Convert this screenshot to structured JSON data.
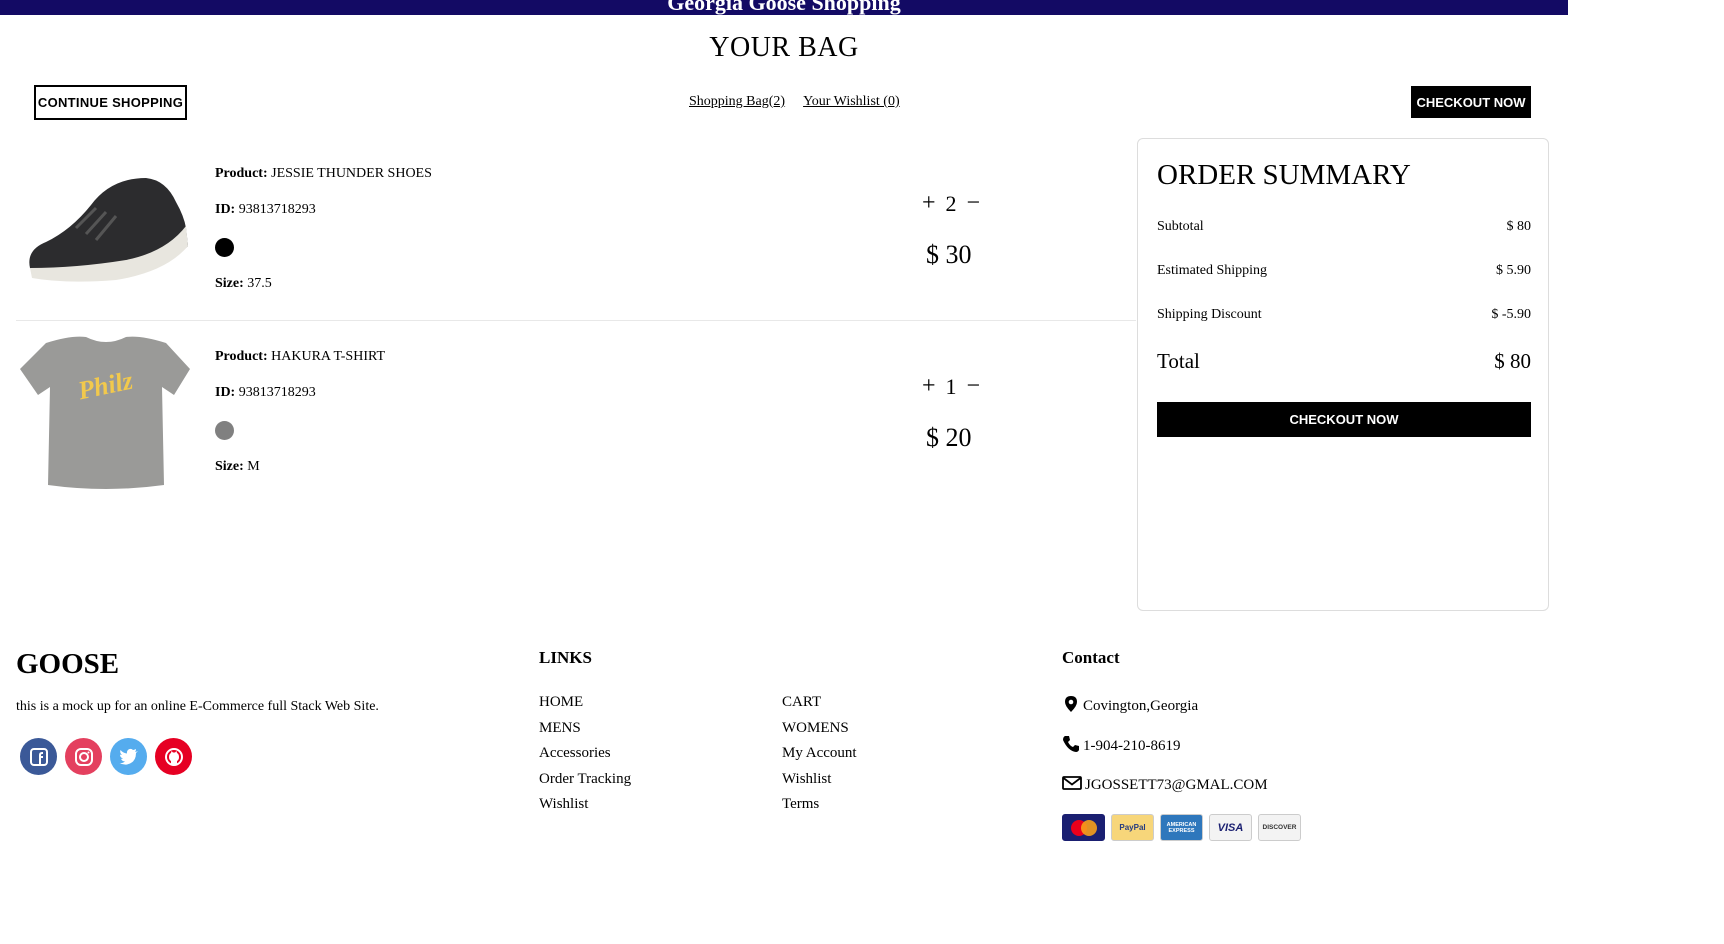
{
  "header": {
    "site_title": "Georgia Goose Shopping"
  },
  "page": {
    "title": "YOUR BAG"
  },
  "toolbar": {
    "continue_label": "CONTINUE SHOPPING",
    "shopping_bag_link": "Shopping Bag(2)",
    "wishlist_link": "Your Wishlist (0)",
    "checkout_label": "CHECKOUT NOW"
  },
  "cart": {
    "items": [
      {
        "product_label": "Product:",
        "product": "JESSIE THUNDER SHOES",
        "id_label": "ID:",
        "id": "93813718293",
        "color": "#000000",
        "size_label": "Size:",
        "size": "37.5",
        "plus": "+",
        "minus": "−",
        "quantity": "2",
        "price": "$ 30",
        "image_icon": "shoe-image"
      },
      {
        "product_label": "Product:",
        "product": "HAKURA T-SHIRT",
        "id_label": "ID:",
        "id": "93813718293",
        "color": "#808080",
        "size_label": "Size:",
        "size": "M",
        "plus": "+",
        "minus": "−",
        "quantity": "1",
        "price": "$ 20",
        "image_icon": "tshirt-image",
        "image_text": "Philz"
      }
    ]
  },
  "summary": {
    "title": "ORDER SUMMARY",
    "subtotal_label": "Subtotal",
    "subtotal": "$ 80",
    "shipping_label": "Estimated Shipping",
    "shipping": "$ 5.90",
    "discount_label": "Shipping Discount",
    "discount": "$ -5.90",
    "total_label": "Total",
    "total": "$ 80",
    "checkout_label": "CHECKOUT NOW"
  },
  "footer": {
    "brand": "GOOSE",
    "description": "this is a mock up for an online E-Commerce full Stack Web Site.",
    "social_icons": [
      "facebook-icon",
      "instagram-icon",
      "twitter-icon",
      "github-icon"
    ],
    "links_heading": "LINKS",
    "links_col1": [
      "HOME",
      "MENS",
      "Accessories",
      "Order Tracking",
      "Wishlist"
    ],
    "links_col2": [
      "CART",
      "WOMENS",
      "My Account",
      "Wishlist",
      "Terms"
    ],
    "contact_heading": "Contact",
    "address": "Covington,Georgia",
    "phone": "1-904-210-8619",
    "email": "JGOSSETT73@GMAL.COM",
    "payment_cards": [
      "MasterCard",
      "PayPal",
      "AMERICAN EXPRESS",
      "VISA",
      "DISCOVER"
    ]
  },
  "colors": {
    "header_bg": "#130a64",
    "facebook": "#3b5998",
    "instagram": "#e4405f",
    "twitter": "#55acee",
    "github": "#e60023"
  }
}
